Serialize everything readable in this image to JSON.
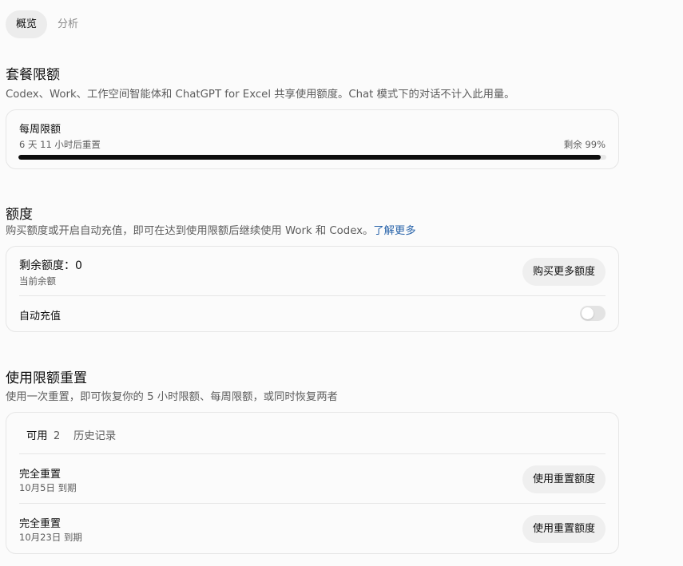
{
  "tabs": [
    {
      "label": "概览",
      "active": true
    },
    {
      "label": "分析",
      "active": false
    }
  ],
  "plan_limits": {
    "title": "套餐限额",
    "description": "Codex、Work、工作空间智能体和 ChatGPT for Excel 共享使用额度。Chat 模式下的对话不计入此用量。",
    "weekly": {
      "title": "每周限额",
      "reset_text": "6 天 11 小时后重置",
      "remaining_text": "剩余 99%",
      "remaining_fraction": 0.99
    }
  },
  "credits": {
    "title": "额度",
    "description": "购买额度或开启自动充值，即可在达到使用限额后继续使用 Work 和 Codex。",
    "learn_more": "了解更多",
    "remaining_label": "剩余额度：0",
    "current_balance": "当前余额",
    "buy_button": "购买更多额度",
    "auto_recharge_label": "自动充值",
    "auto_recharge_on": false
  },
  "resets": {
    "title": "使用限额重置",
    "description": "使用一次重置，即可恢复你的 5 小时限额、每周限额，或同时恢复两者",
    "tabs": {
      "available_label": "可用",
      "available_count": "2",
      "history_label": "历史记录"
    },
    "items": [
      {
        "title": "完全重置",
        "expiry": "10月5日 到期",
        "button": "使用重置额度"
      },
      {
        "title": "完全重置",
        "expiry": "10月23日 到期",
        "button": "使用重置额度"
      }
    ]
  },
  "colors": {
    "link": "#2964aa",
    "progress_fill": "#0d0d0d",
    "pill_bg": "#efefef",
    "card_border": "#e6e6e6"
  }
}
